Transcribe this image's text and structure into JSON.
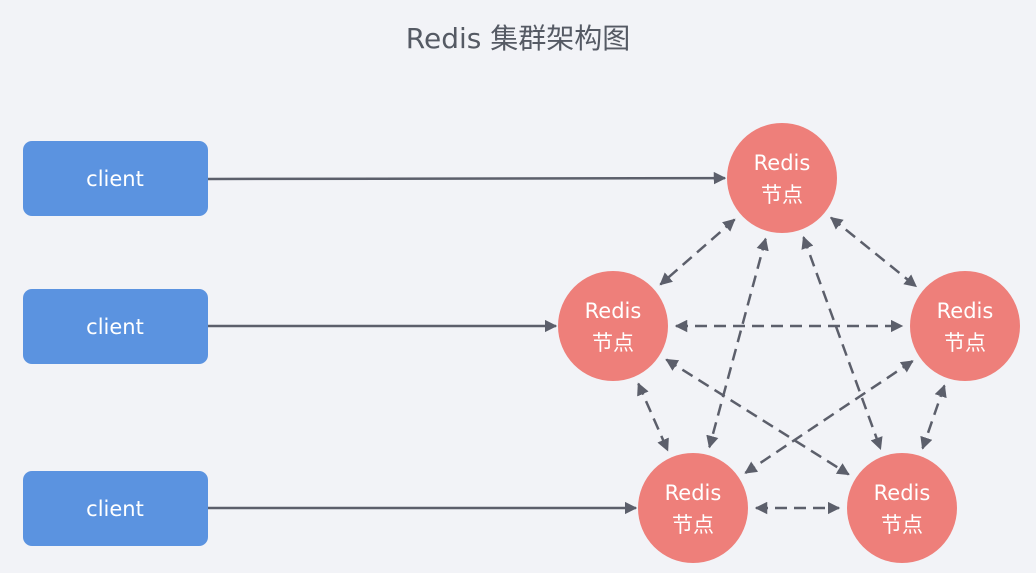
{
  "title": "Redis 集群架构图",
  "clients": [
    {
      "label": "client"
    },
    {
      "label": "client"
    },
    {
      "label": "client"
    }
  ],
  "nodes": [
    {
      "line1": "Redis",
      "line2": "节点"
    },
    {
      "line1": "Redis",
      "line2": "节点"
    },
    {
      "line1": "Redis",
      "line2": "节点"
    },
    {
      "line1": "Redis",
      "line2": "节点"
    },
    {
      "line1": "Redis",
      "line2": "节点"
    }
  ],
  "client_links": [
    {
      "client": 0,
      "node": 0
    },
    {
      "client": 1,
      "node": 1
    },
    {
      "client": 2,
      "node": 3
    }
  ],
  "node_links": [
    [
      0,
      1
    ],
    [
      0,
      2
    ],
    [
      0,
      3
    ],
    [
      0,
      4
    ],
    [
      1,
      2
    ],
    [
      1,
      3
    ],
    [
      1,
      4
    ],
    [
      2,
      3
    ],
    [
      2,
      4
    ],
    [
      3,
      4
    ]
  ],
  "colors": {
    "client": "#5b93e0",
    "node": "#ee7f7a",
    "link": "#5c5f6b",
    "background": "#f2f3f7",
    "title": "#555a64"
  }
}
